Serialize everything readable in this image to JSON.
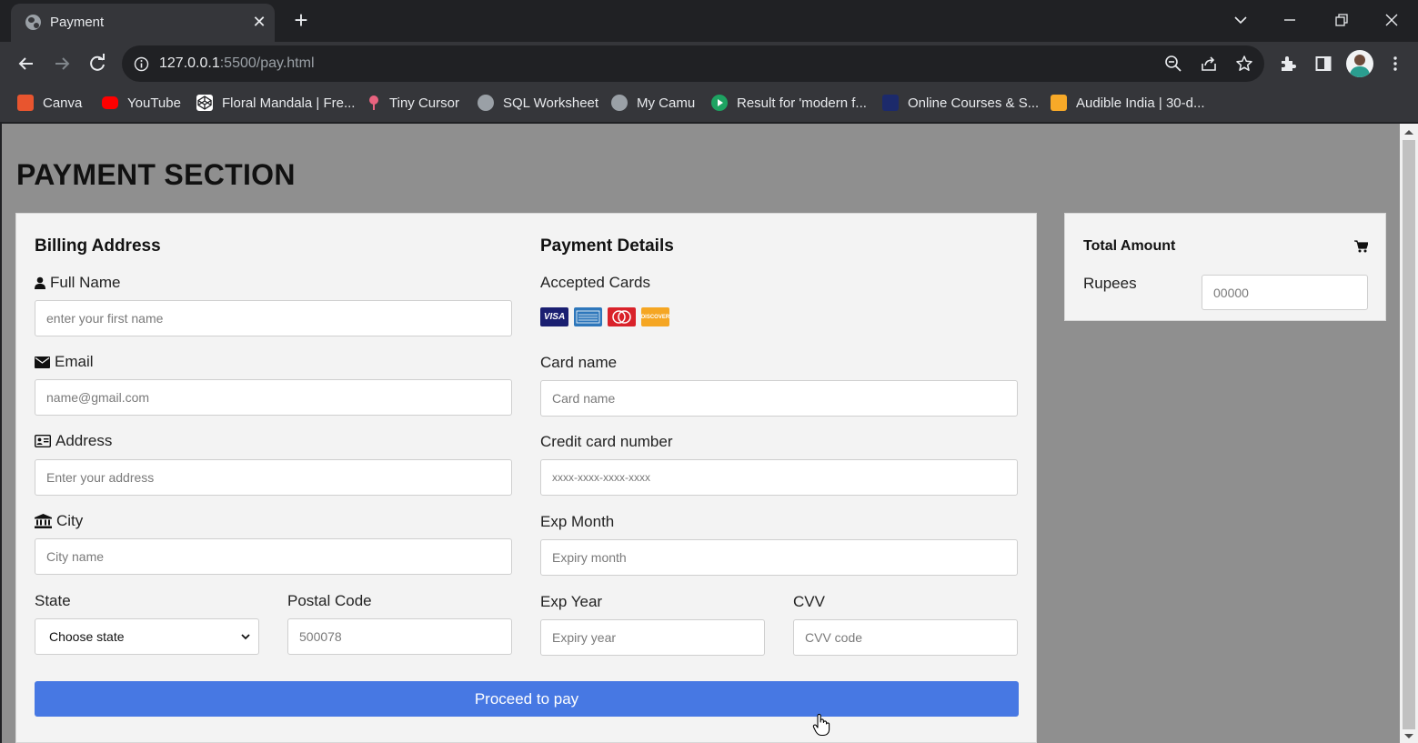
{
  "browser": {
    "tab_title": "Payment",
    "tab_close": "✕",
    "new_tab": "+",
    "url_host": "127.0.0.1",
    "url_path": ":5500/pay.html",
    "bookmarks": [
      {
        "label": "Canva",
        "icon": "canva-icon",
        "color": "#e8552f"
      },
      {
        "label": "YouTube",
        "icon": "youtube-icon",
        "color": "#ff0000"
      },
      {
        "label": "Floral Mandala | Fre...",
        "icon": "codepen-icon",
        "color": "#ffffff"
      },
      {
        "label": "Tiny Cursor",
        "icon": "tiny-cursor-icon",
        "color": "#e9637f"
      },
      {
        "label": "SQL Worksheet",
        "icon": "globe-icon",
        "color": "#9aa0a6"
      },
      {
        "label": "My Camu",
        "icon": "globe-icon",
        "color": "#9aa0a6"
      },
      {
        "label": "Result for 'modern f...",
        "icon": "play-icon",
        "color": "#1ea362"
      },
      {
        "label": "Online Courses & S...",
        "icon": "courses-icon",
        "color": "#1c2a6b"
      },
      {
        "label": "Audible India | 30-d...",
        "icon": "audible-icon",
        "color": "#f7a928"
      }
    ]
  },
  "page": {
    "title": "PAYMENT SECTION",
    "billing": {
      "heading": "Billing Address",
      "full_name_label": "Full Name",
      "full_name_placeholder": "enter your first name",
      "email_label": "Email",
      "email_placeholder": "name@gmail.com",
      "address_label": "Address",
      "address_placeholder": "Enter your address",
      "city_label": "City",
      "city_placeholder": "City name",
      "state_label": "State",
      "state_value": "Choose state",
      "postal_label": "Postal Code",
      "postal_placeholder": "500078"
    },
    "payment": {
      "heading": "Payment Details",
      "accepted_label": "Accepted Cards",
      "cards": [
        "VISA",
        "AMEX",
        "Mastercard",
        "DISCOVER"
      ],
      "card_name_label": "Card name",
      "card_name_placeholder": "Card name",
      "card_number_label": "Credit card number",
      "card_number_placeholder": "xxxx-xxxx-xxxx-xxxx",
      "exp_month_label": "Exp Month",
      "exp_month_placeholder": "Expiry month",
      "exp_year_label": "Exp Year",
      "exp_year_placeholder": "Expiry year",
      "cvv_label": "CVV",
      "cvv_placeholder": "CVV code"
    },
    "pay_button": "Proceed to pay",
    "total": {
      "heading": "Total Amount",
      "rupees_label": "Rupees",
      "rupees_placeholder": "00000"
    }
  },
  "colors": {
    "page_bg": "#8f8f8f",
    "card_bg": "#f3f3f3",
    "button_blue": "#4778e3"
  }
}
